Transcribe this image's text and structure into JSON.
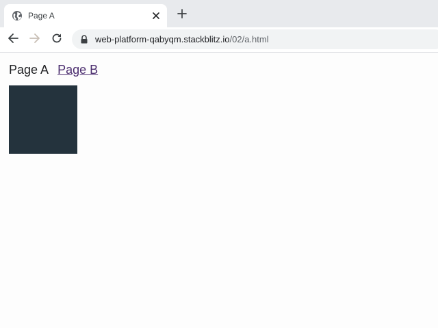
{
  "tab": {
    "title": "Page A",
    "favicon": "globe-icon"
  },
  "toolbar": {
    "back_icon": "arrow-left-icon",
    "forward_icon": "arrow-right-icon",
    "reload_icon": "reload-icon",
    "url_host": "web-platform-qabyqm.stackblitz.io",
    "url_path": "/02/a.html"
  },
  "page": {
    "current_label": "Page A",
    "link_label": "Page B",
    "square_color": "#24333d",
    "link_color": "#4a2c6e"
  }
}
